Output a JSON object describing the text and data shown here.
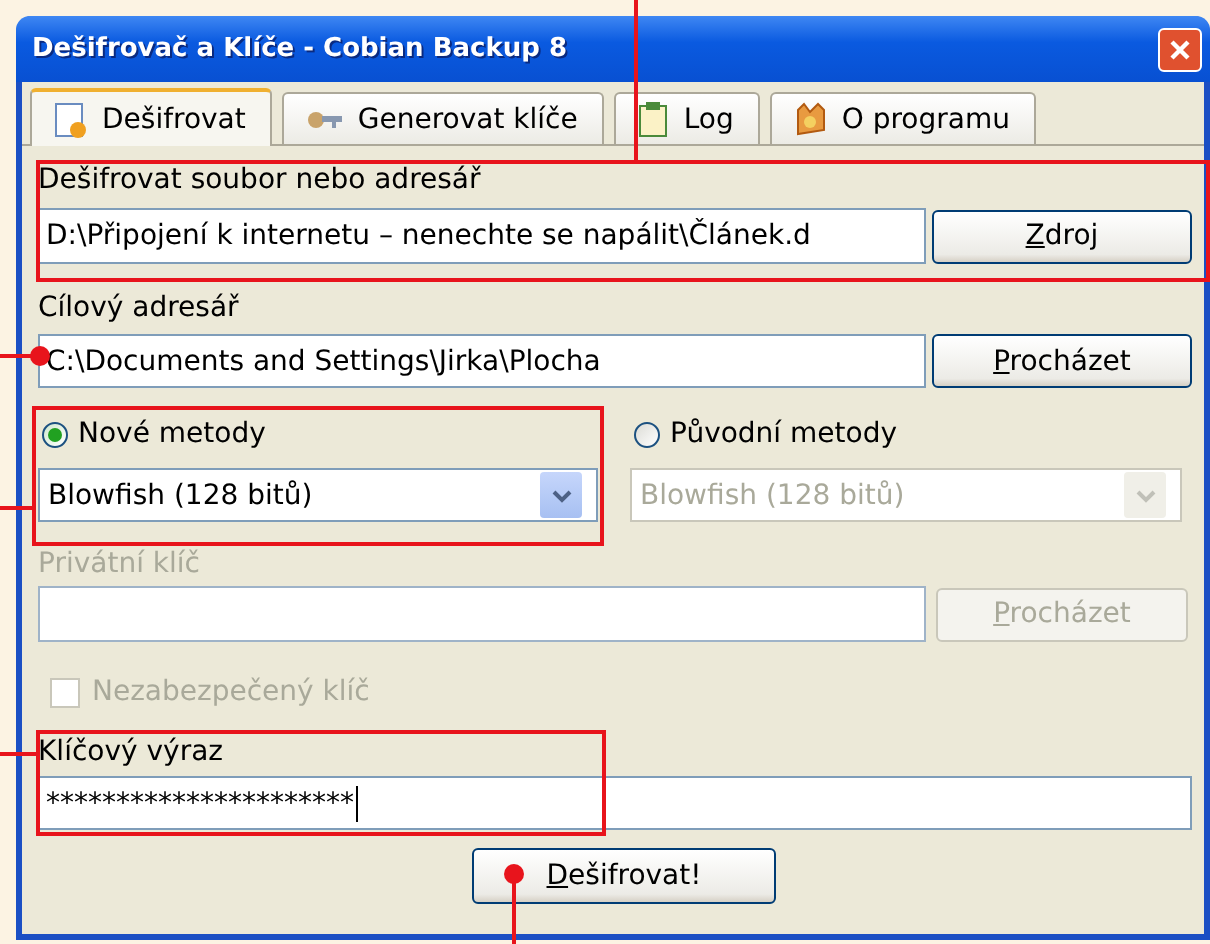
{
  "window": {
    "title": "Dešifrovač a Klíče - Cobian Backup 8"
  },
  "tabs": [
    {
      "label": "Dešifrovat",
      "selected": true
    },
    {
      "label": "Generovat klíče",
      "selected": false
    },
    {
      "label": "Log",
      "selected": false
    },
    {
      "label": "O programu",
      "selected": false
    }
  ],
  "source": {
    "label": "Dešifrovat soubor nebo adresář",
    "value": "D:\\Připojení k internetu – nenechte se napálit\\Článek.d",
    "button": "Zdroj"
  },
  "destination": {
    "label": "Cílový adresář",
    "value": "C:\\Documents and Settings\\Jirka\\Plocha",
    "button": "Procházet"
  },
  "methods": [
    {
      "label": "Nové metody",
      "selected": true,
      "combo": "Blowfish (128 bitů)",
      "disabled": false
    },
    {
      "label": "Původní metody",
      "selected": false,
      "combo": "Blowfish (128 bitů)",
      "disabled": true
    }
  ],
  "private_key": {
    "label": "Privátní klíč",
    "button": "Procházet",
    "disabled": true
  },
  "insecure_key": {
    "label": "Nezabezpečený klíč",
    "checked": false,
    "disabled": true
  },
  "passphrase": {
    "label": "Klíčový výraz",
    "value": "**********************"
  },
  "action_button": "Dešifrovat!"
}
